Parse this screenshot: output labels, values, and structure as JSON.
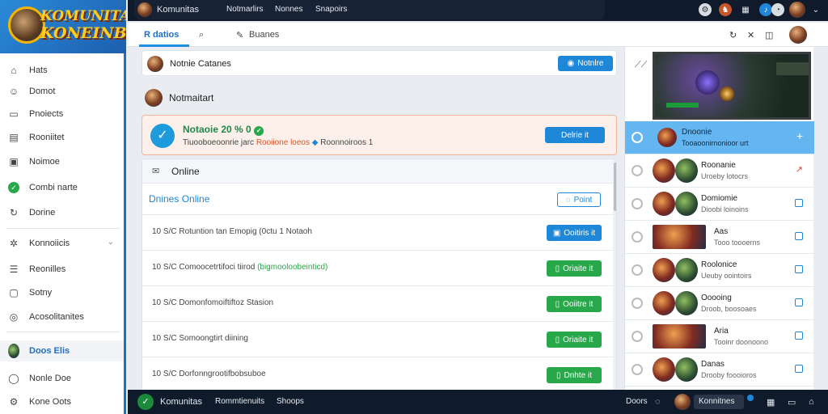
{
  "brand": {
    "line1": "KOMUNITAS",
    "line2": "KONEINBS"
  },
  "sidebar": {
    "items": [
      {
        "label": "Hats",
        "icon": "home-icon"
      },
      {
        "label": "Domot",
        "icon": "people-icon"
      },
      {
        "label": "Pnoiects",
        "icon": "folder-icon"
      },
      {
        "label": "Rooniitet",
        "icon": "chat-icon"
      },
      {
        "label": "Noimoe",
        "icon": "box-icon"
      },
      {
        "label": "Combi narte",
        "icon": "check-circle-icon"
      },
      {
        "label": "Dorine",
        "icon": "refresh-icon"
      },
      {
        "label": "Konnoiicis",
        "icon": "star-icon"
      },
      {
        "label": "Reonilles",
        "icon": "list-icon"
      },
      {
        "label": "Sotny",
        "icon": "doc-icon"
      },
      {
        "label": "Acosolitanites",
        "icon": "globe-icon"
      },
      {
        "label": "Doos Elis",
        "icon": "avatar"
      },
      {
        "label": "Nonle Doe",
        "icon": "chat-bubble-icon"
      },
      {
        "label": "Kone Oots",
        "icon": "settings-icon"
      }
    ]
  },
  "topbar": {
    "user": "Komunitas",
    "tab1": "Notmarlirs",
    "tab2": "Nonnes",
    "tab3": "Snapoirs"
  },
  "toolbar": {
    "tab": "R datios",
    "search_label": "Buanes"
  },
  "notice": {
    "text": "Notnie Catanes",
    "button": "Notnlre"
  },
  "section": {
    "title": "Notmaitart"
  },
  "alert": {
    "title": "Notaoie 20 % 0",
    "sub_prefix": "Tiuooboeoonrie jarc",
    "sub_highlight": "Rooiione loeos",
    "sub_suffix": "Roonnoiroos 1",
    "button": "Delrie it"
  },
  "online": {
    "header": "Online",
    "subheader": "Dnines Online",
    "point_button": "Point"
  },
  "rows": [
    {
      "prefix": "10 S/C",
      "text": "Rotuntion tan Emopig (0ctu 1 Notaoh",
      "highlight": "",
      "button": "Ooitiris it",
      "color": "blue"
    },
    {
      "prefix": "10 S/C",
      "text": "Comoocetrtifoci tiirod",
      "highlight": "(bigmooloobeinticd)",
      "button": "Oriaite it",
      "color": "green"
    },
    {
      "prefix": "10 S/C",
      "text": "Domonfomoiftiftoz Stasion",
      "highlight": "",
      "button": "Ooiitre it",
      "color": "green"
    },
    {
      "prefix": "10 S/C",
      "text": "Somoongtirt diining",
      "highlight": "",
      "button": "Oriaite it",
      "color": "green"
    },
    {
      "prefix": "10 S/C",
      "text": "Dorfonngrootifbobsuboe",
      "highlight": "",
      "button": "Dnhte it",
      "color": "green"
    }
  ],
  "friends": [
    {
      "name": "Dnoonie",
      "sub": "Tooaoonirnonioor urt",
      "selected": true
    },
    {
      "name": "Roonanie",
      "sub": "Uroeby lotocrs",
      "selected": false
    },
    {
      "name": "Domiomie",
      "sub": "Dioobi loinoins",
      "selected": false
    },
    {
      "name": "Aas",
      "sub": "Tooo toooerns",
      "selected": false
    },
    {
      "name": "Roolonice",
      "sub": "Ueuby oointoirs",
      "selected": false
    },
    {
      "name": "Ooooing",
      "sub": "Droob, boosoaes",
      "selected": false
    },
    {
      "name": "Aria",
      "sub": "Tooinr doonoono",
      "selected": false
    },
    {
      "name": "Danas",
      "sub": "Drooby foooioros",
      "selected": false
    }
  ],
  "bottombar": {
    "brand": "Komunitas",
    "link1": "Rommtienuits",
    "link2": "Shoops",
    "status": "Doors",
    "user": "Konnitnes"
  }
}
